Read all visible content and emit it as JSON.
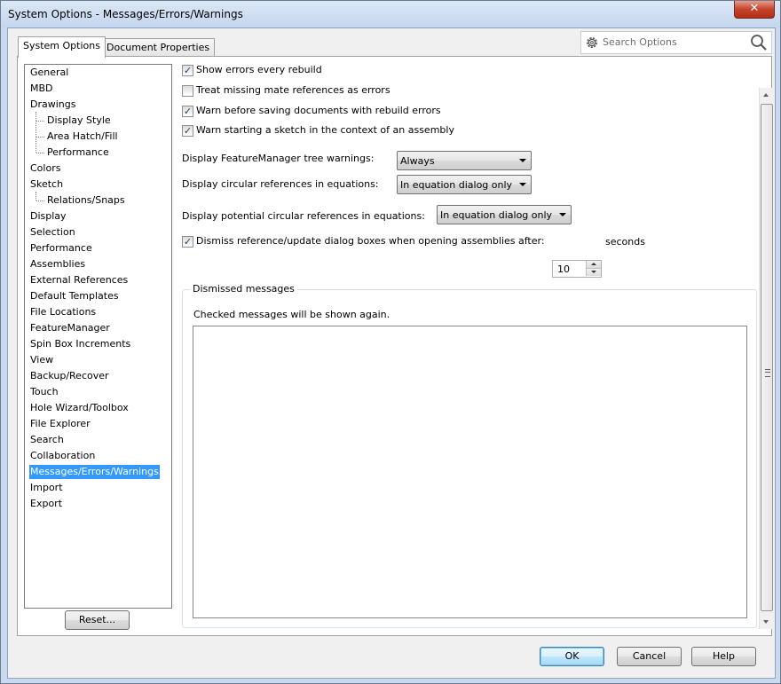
{
  "window": {
    "title": "System Options - Messages/Errors/Warnings",
    "close_glyph": "✕"
  },
  "tabs": [
    {
      "label": "System Options",
      "active": true
    },
    {
      "label": "Document Properties",
      "active": false
    }
  ],
  "search": {
    "placeholder": "Search Options",
    "icons": [
      "gear-icon",
      "search-icon"
    ]
  },
  "tree": {
    "items": [
      {
        "label": "General"
      },
      {
        "label": "MBD"
      },
      {
        "label": "Drawings"
      },
      {
        "label": "Display Style",
        "child": true
      },
      {
        "label": "Area Hatch/Fill",
        "child": true
      },
      {
        "label": "Performance",
        "child": true
      },
      {
        "label": "Colors"
      },
      {
        "label": "Sketch"
      },
      {
        "label": "Relations/Snaps",
        "child": true
      },
      {
        "label": "Display"
      },
      {
        "label": "Selection"
      },
      {
        "label": "Performance"
      },
      {
        "label": "Assemblies"
      },
      {
        "label": "External References"
      },
      {
        "label": "Default Templates"
      },
      {
        "label": "File Locations"
      },
      {
        "label": "FeatureManager"
      },
      {
        "label": "Spin Box Increments"
      },
      {
        "label": "View"
      },
      {
        "label": "Backup/Recover"
      },
      {
        "label": "Touch"
      },
      {
        "label": "Hole Wizard/Toolbox"
      },
      {
        "label": "File Explorer"
      },
      {
        "label": "Search"
      },
      {
        "label": "Collaboration"
      },
      {
        "label": "Messages/Errors/Warnings",
        "selected": true
      },
      {
        "label": "Import"
      },
      {
        "label": "Export"
      }
    ]
  },
  "options": {
    "show_errors": {
      "label": "Show errors every rebuild",
      "checked": true
    },
    "treat_missing": {
      "label": "Treat missing mate references as errors",
      "checked": false
    },
    "warn_saving": {
      "label": "Warn before saving documents with rebuild errors",
      "checked": true
    },
    "warn_sketch": {
      "label": "Warn starting a sketch in the context of an assembly",
      "checked": true
    },
    "fm_warnings": {
      "label": "Display FeatureManager tree warnings:",
      "value": "Always"
    },
    "circ_refs": {
      "label": "Display circular references in equations:",
      "value": "In equation dialog only"
    },
    "potential_circ": {
      "label": "Display potential circular references in equations:",
      "value": "In equation dialog only"
    },
    "dismiss": {
      "label": "Dismiss reference/update dialog boxes when opening assemblies after:",
      "checked": true,
      "value": "10",
      "unit": "seconds"
    }
  },
  "dismissed": {
    "title": "Dismissed messages",
    "hint": "Checked messages will be shown again."
  },
  "buttons": {
    "reset": "Reset...",
    "ok": "OK",
    "cancel": "Cancel",
    "help": "Help"
  },
  "check_glyph": "✓"
}
